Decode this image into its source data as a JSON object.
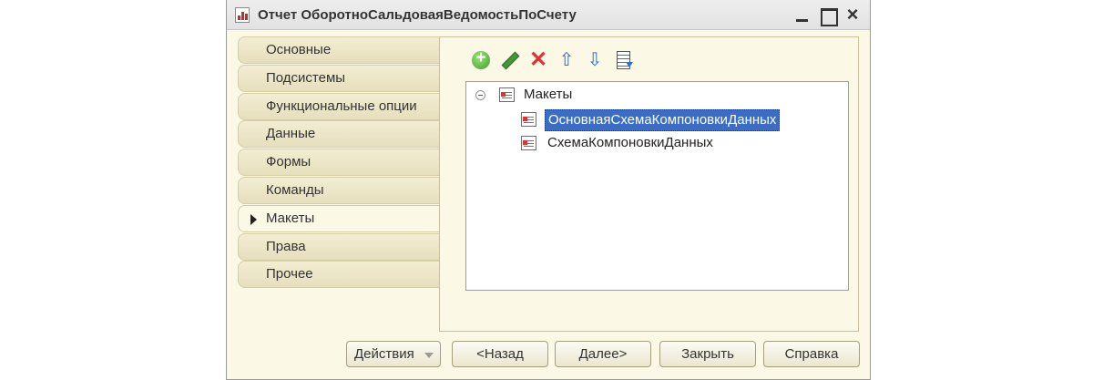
{
  "window": {
    "title": "Отчет ОборотноСальдоваяВедомостьПоСчету",
    "icon": "report-icon"
  },
  "tabs": [
    {
      "label": "Основные",
      "active": false
    },
    {
      "label": "Подсистемы",
      "active": false
    },
    {
      "label": "Функциональные опции",
      "active": false
    },
    {
      "label": "Данные",
      "active": false
    },
    {
      "label": "Формы",
      "active": false
    },
    {
      "label": "Команды",
      "active": false
    },
    {
      "label": "Макеты",
      "active": true
    },
    {
      "label": "Права",
      "active": false
    },
    {
      "label": "Прочее",
      "active": false
    }
  ],
  "toolbar": {
    "icons": [
      "add-icon",
      "edit-icon",
      "delete-icon",
      "move-up-icon",
      "move-down-icon",
      "list-icon"
    ]
  },
  "tree": {
    "root": {
      "label": "Макеты",
      "expanded": true
    },
    "items": [
      {
        "label": "ОсновнаяСхемаКомпоновкиДанных",
        "selected": true
      },
      {
        "label": "СхемаКомпоновкиДанных",
        "selected": false
      }
    ]
  },
  "footer": {
    "actions_label": "Действия",
    "back_label": "<Назад",
    "next_label": "Далее>",
    "close_label": "Закрыть",
    "help_label": "Справка"
  },
  "colors": {
    "selection": "#3b6cc6",
    "panel_bg": "#fbf8e6",
    "tab_bg": "#e6dfbd",
    "delete": "#e23131",
    "add": "#3f9f2b",
    "arrow_blue": "#2f6fd0"
  }
}
